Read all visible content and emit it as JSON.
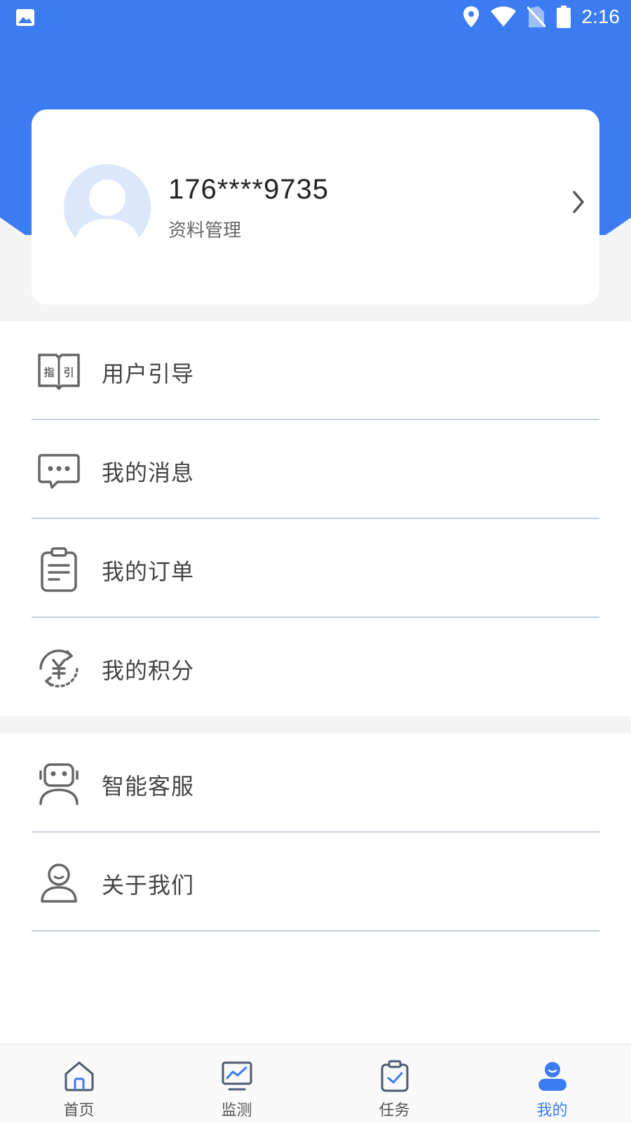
{
  "status_bar": {
    "time": "2:16",
    "icons": [
      "image-icon",
      "location-icon",
      "wifi-icon",
      "no-sim-icon",
      "battery-icon"
    ]
  },
  "profile": {
    "phone": "176****9735",
    "subtitle": "资料管理"
  },
  "menu": {
    "group1": [
      {
        "label": "用户引导",
        "icon": "guide-book-icon",
        "icon_text": "指引"
      },
      {
        "label": "我的消息",
        "icon": "message-icon"
      },
      {
        "label": "我的订单",
        "icon": "order-clipboard-icon"
      },
      {
        "label": "我的积分",
        "icon": "points-yen-icon",
        "icon_text": "¥"
      }
    ],
    "group2": [
      {
        "label": "智能客服",
        "icon": "robot-icon"
      },
      {
        "label": "关于我们",
        "icon": "person-icon"
      }
    ]
  },
  "nav": {
    "items": [
      {
        "label": "首页",
        "icon": "home-icon"
      },
      {
        "label": "监测",
        "icon": "monitor-icon"
      },
      {
        "label": "任务",
        "icon": "task-icon"
      },
      {
        "label": "我的",
        "icon": "profile-icon"
      }
    ],
    "active_index": 3
  },
  "colors": {
    "primary": "#3b7cf2",
    "background": "#f4f4f4",
    "divider": "#c5cfdc"
  }
}
